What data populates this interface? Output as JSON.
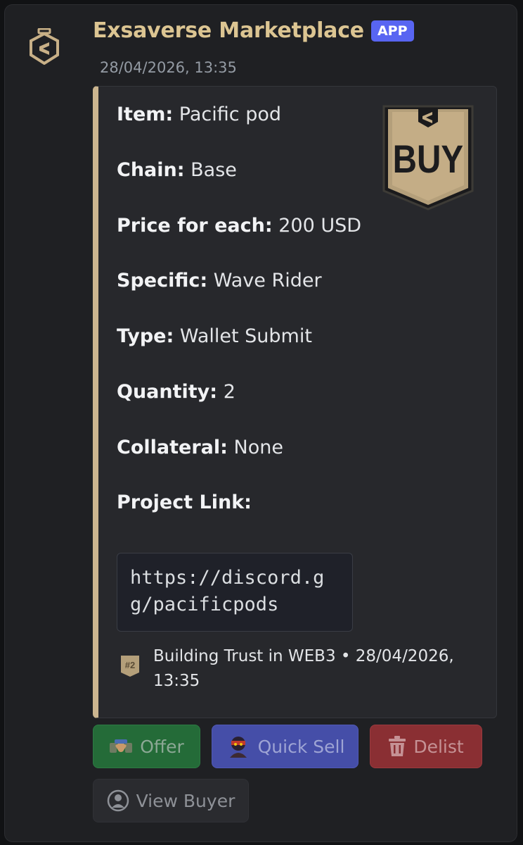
{
  "message": {
    "author": "Exsaverse Marketplace",
    "badge": "APP",
    "timestamp": "28/04/2026, 13:35",
    "avatar_icon": "exsaverse-shield-icon"
  },
  "embed": {
    "accent_color": "#cbb58f",
    "thumbnail_text": "BUY",
    "fields": [
      {
        "label": "Item:",
        "value": "Pacific pod"
      },
      {
        "label": "Chain:",
        "value": "Base"
      },
      {
        "label": "Price for each:",
        "value": "200 USD"
      },
      {
        "label": "Specific:",
        "value": "Wave Rider"
      },
      {
        "label": "Type:",
        "value": "Wallet Submit"
      },
      {
        "label": "Quantity:",
        "value": "2"
      },
      {
        "label": "Collateral:",
        "value": "None"
      },
      {
        "label": "Project Link:",
        "value": ""
      }
    ],
    "project_link": "https://discord.gg/pacificpods",
    "footer": {
      "icon_text": "#2",
      "text": "Building Trust in WEB3 • 28/04/2026, 13:35"
    }
  },
  "buttons": {
    "offer": {
      "label": "Offer",
      "icon": "handshake-icon",
      "color": "#246b38"
    },
    "quick_sell": {
      "label": "Quick Sell",
      "icon": "character-avatar-icon",
      "color": "#454ea8"
    },
    "delist": {
      "label": "Delist",
      "icon": "trash-icon",
      "color": "#8a2f33"
    },
    "view_buyer": {
      "label": "View Buyer",
      "icon": "user-circle-icon",
      "color": "#2a2b2f"
    }
  }
}
